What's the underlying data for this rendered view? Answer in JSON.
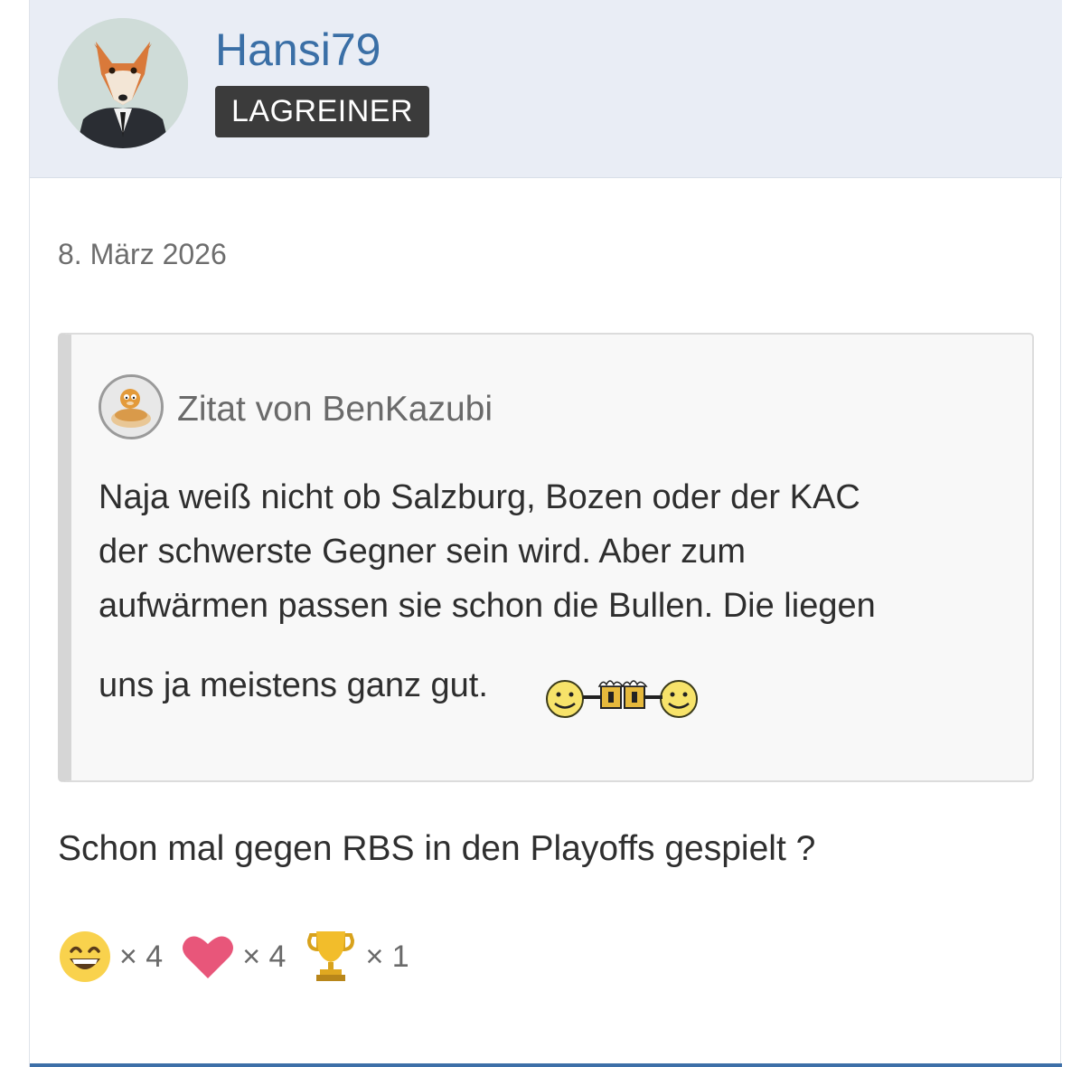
{
  "post": {
    "author": {
      "username": "Hansi79",
      "rank": "LAGREINER"
    },
    "date": "8. März 2026",
    "quote": {
      "author_label": "Zitat von BenKazubi",
      "lines": [
        "Naja weiß nicht ob Salzburg, Bozen oder der KAC",
        "der schwerste Gegner sein wird. Aber zum",
        "aufwärmen passen sie schon die Bullen. Die liegen"
      ],
      "last_line": "uns ja meistens ganz gut."
    },
    "body_text": "Schon mal gegen RBS in den Playoffs gespielt ?",
    "reactions": [
      {
        "icon": "grinning-face-icon",
        "count": "× 4"
      },
      {
        "icon": "heart-icon",
        "count": "× 4"
      },
      {
        "icon": "trophy-icon",
        "count": "× 1"
      }
    ]
  },
  "colors": {
    "header_bg": "#e9edf5",
    "username": "#3a6fa6",
    "rank_badge": "#3b3b3b",
    "quote_bg": "#f8f8f8",
    "accent_line": "#3d6fa8"
  }
}
